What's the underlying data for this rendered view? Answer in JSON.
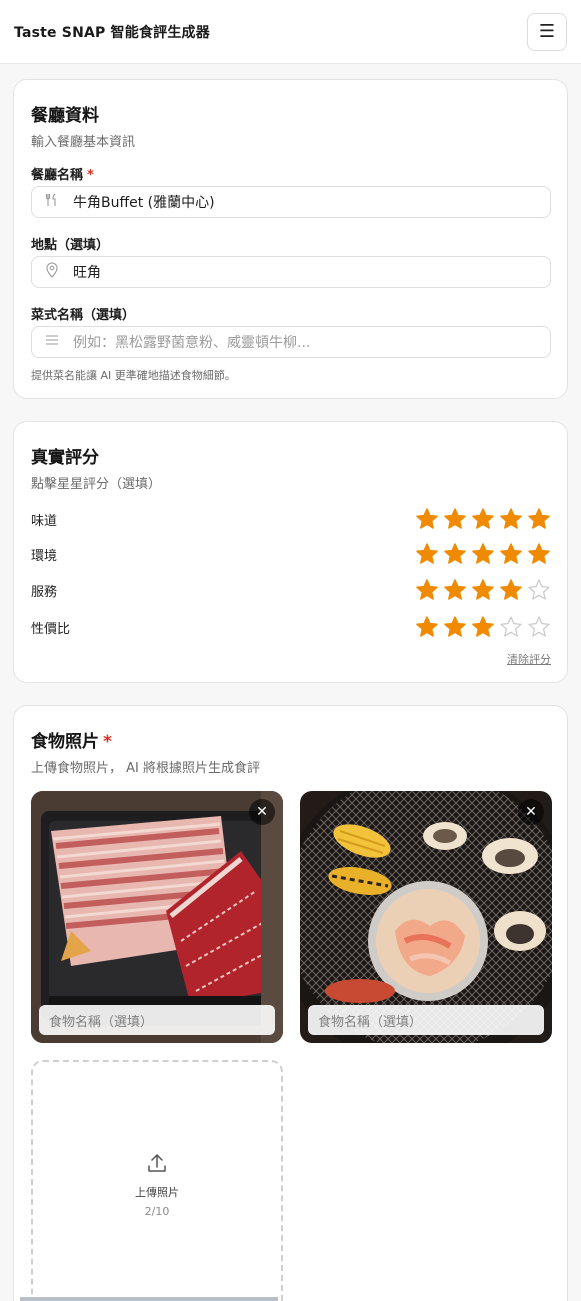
{
  "app": {
    "title": "Taste SNAP 智能食評生成器",
    "menu_icon": "hamburger-icon"
  },
  "restaurant": {
    "title": "餐廳資料",
    "subtitle": "輸入餐廳基本資訊",
    "name_label": "餐廳名稱",
    "required_mark": "*",
    "name_value": "牛角Buffet (雅蘭中心)",
    "location_label": "地點（選填）",
    "location_value": "旺角",
    "dish_label": "菜式名稱（選填）",
    "dish_placeholder": "例如：黑松露野菌意粉、威靈頓牛柳...",
    "hint": "提供菜名能讓 AI 更準確地描述食物細節。"
  },
  "rating": {
    "title": "真實評分",
    "subtitle": "點擊星星評分（選填）",
    "items": [
      {
        "label": "味道",
        "stars": 5
      },
      {
        "label": "環境",
        "stars": 5
      },
      {
        "label": "服務",
        "stars": 4
      },
      {
        "label": "性價比",
        "stars": 3
      }
    ],
    "max_stars": 5,
    "clear_label": "清除評分",
    "star_color": "#f08a00"
  },
  "photos": {
    "title": "食物照片",
    "required_mark": "*",
    "subtitle": "上傳食物照片， AI 將根據照片生成食評",
    "items": [
      {
        "name_placeholder": "食物名稱（選填）",
        "close": "✕"
      },
      {
        "name_placeholder": "食物名稱（選填）",
        "close": "✕"
      }
    ],
    "upload_label": "上傳照片",
    "upload_count": "2/10"
  }
}
